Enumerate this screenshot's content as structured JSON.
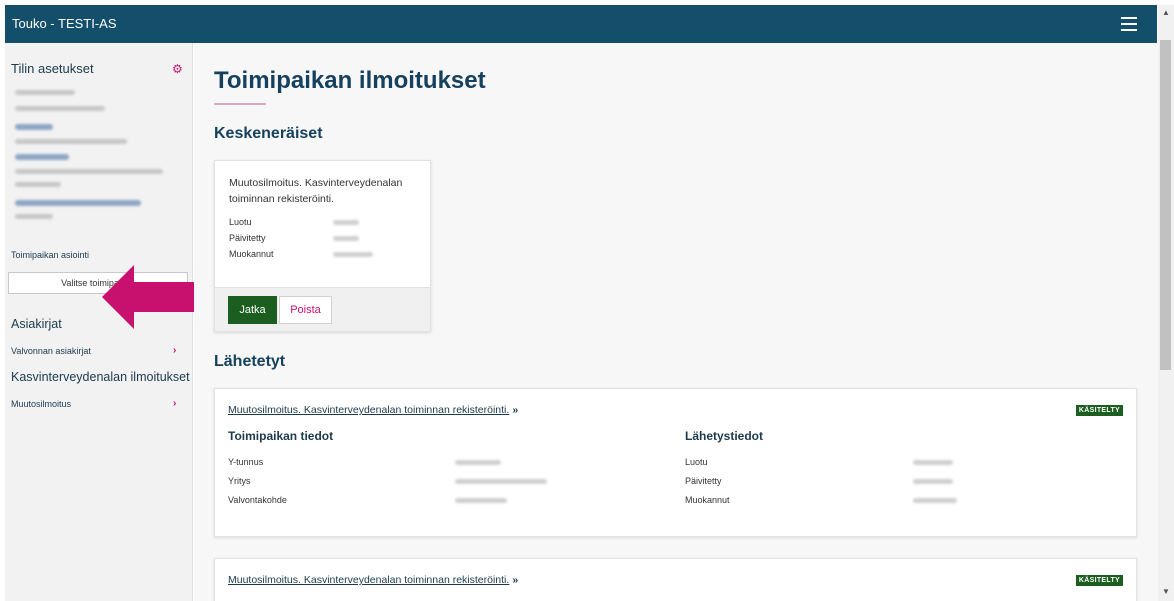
{
  "app": {
    "title": "Touko - TESTI-AS"
  },
  "sidebar": {
    "account_settings": "Tilin asetukset",
    "workplace_label": "Toimipaikan asiointi",
    "select_workplace_button": "Valitse toimipaikka",
    "documents_heading": "Asiakirjat",
    "documents_items": [
      {
        "label": "Valvonnan asiakirjat"
      }
    ],
    "notifications_heading": "Kasvinterveydenalan ilmoitukset",
    "notifications_items": [
      {
        "label": "Muutosilmoitus"
      }
    ]
  },
  "main": {
    "title": "Toimipaikan ilmoitukset",
    "in_progress_heading": "Keskeneräiset",
    "draft": {
      "title": "Muutosilmoitus. Kasvinterveydenalan toiminnan rekisteröinti.",
      "labels": [
        "Luotu",
        "Päivitetty",
        "Muokannut"
      ],
      "continue_button": "Jatka",
      "delete_button": "Poista"
    },
    "sent_heading": "Lähetetyt",
    "sent": [
      {
        "link": "Muutosilmoitus. Kasvinterveydenalan toiminnan rekisteröinti.",
        "badge": "KÄSITELTY",
        "place_heading": "Toimipaikan tiedot",
        "place_labels": [
          "Y-tunnus",
          "Yritys",
          "Valvontakohde"
        ],
        "send_heading": "Lähetystiedot",
        "send_labels": [
          "Luotu",
          "Päivitetty",
          "Muokannut"
        ]
      },
      {
        "link": "Muutosilmoitus. Kasvinterveydenalan toiminnan rekisteröinti.",
        "badge": "KÄSITELTY"
      }
    ]
  },
  "colors": {
    "header": "#134e6b",
    "accent": "#c8106e",
    "primary_button": "#1b5e20"
  }
}
